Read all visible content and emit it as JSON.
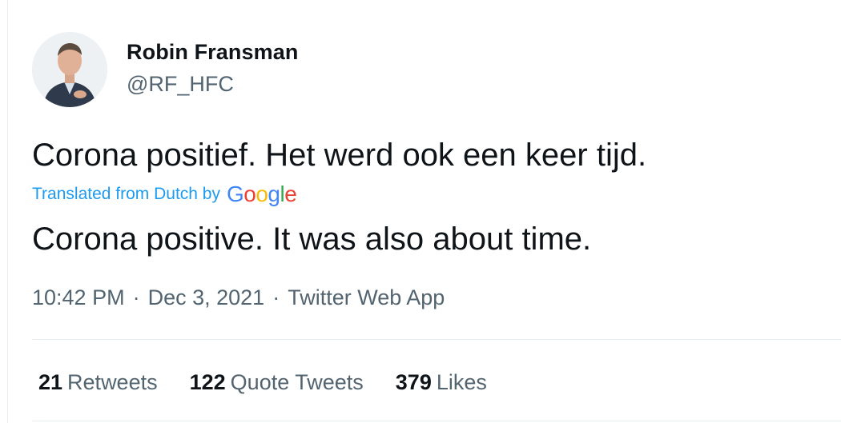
{
  "author": {
    "name": "Robin Fransman",
    "handle": "@RF_HFC"
  },
  "tweet": {
    "text_original": "Corona positief. Het werd ook een keer tijd.",
    "translated_label": "Translated from Dutch by",
    "google_logo": [
      "G",
      "o",
      "o",
      "g",
      "l",
      "e"
    ],
    "google_colors": [
      "#4285f4",
      "#ea4335",
      "#fbbc05",
      "#4285f4",
      "#34a853",
      "#ea4335"
    ],
    "text_translated": "Corona positive. It was also about time."
  },
  "meta": {
    "time": "10:42 PM",
    "date": "Dec 3, 2021",
    "source": "Twitter Web App",
    "separator": "·"
  },
  "stats": {
    "retweets_count": "21",
    "retweets_label": "Retweets",
    "quotes_count": "122",
    "quotes_label": "Quote Tweets",
    "likes_count": "379",
    "likes_label": "Likes"
  },
  "colors": {
    "accent": "#1d9bf0",
    "secondary_text": "#536471",
    "primary_text": "#0f1419"
  }
}
